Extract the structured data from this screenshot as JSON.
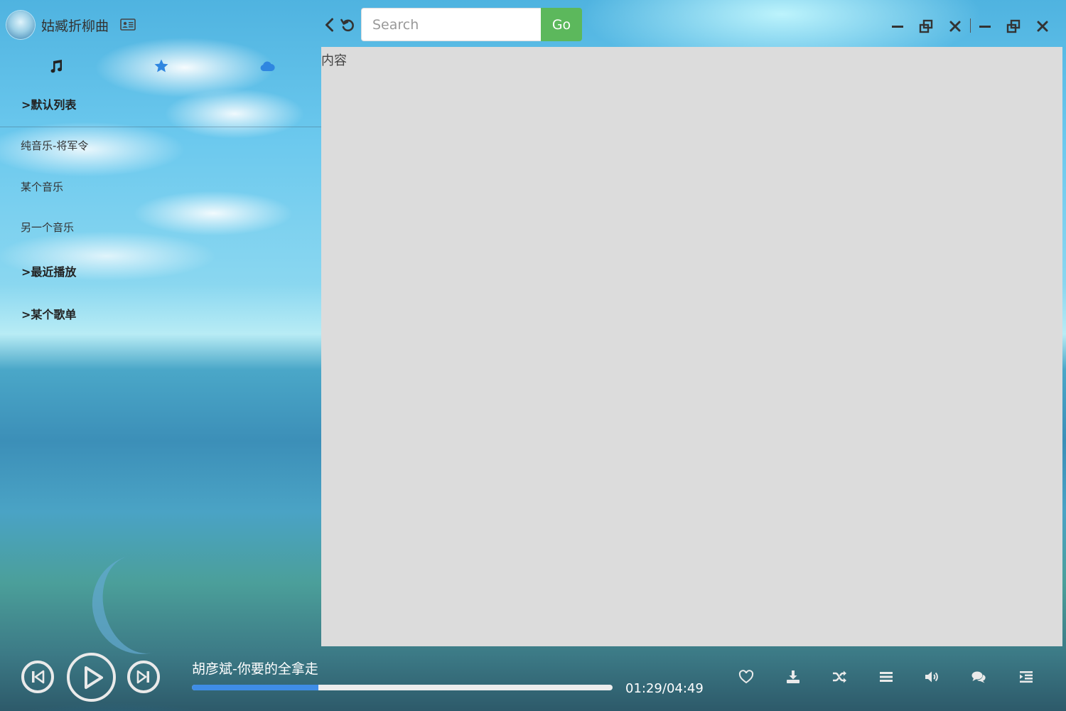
{
  "app": {
    "title": "姑臧折柳曲"
  },
  "sidebar": {
    "tabs": [
      {
        "icon": "music-note-icon"
      },
      {
        "icon": "star-icon"
      },
      {
        "icon": "cloud-icon"
      }
    ],
    "groups": [
      {
        "label": ">默认列表"
      },
      {
        "label": ">最近播放"
      },
      {
        "label": ">某个歌单"
      }
    ],
    "songs": [
      {
        "label": "纯音乐-将军令"
      },
      {
        "label": "某个音乐"
      },
      {
        "label": "另一个音乐"
      }
    ]
  },
  "topbar": {
    "search_placeholder": "Search",
    "go_label": "Go"
  },
  "content": {
    "text": "内容"
  },
  "player": {
    "track_title": "胡彦斌-你要的全拿走",
    "time": "01:29/04:49",
    "progress": 0.3
  },
  "colors": {
    "accent_blue": "#3f8de6",
    "go_green": "#5cb85c",
    "content_bg": "#dcdcdc",
    "tab_active": "#2f86e0"
  }
}
